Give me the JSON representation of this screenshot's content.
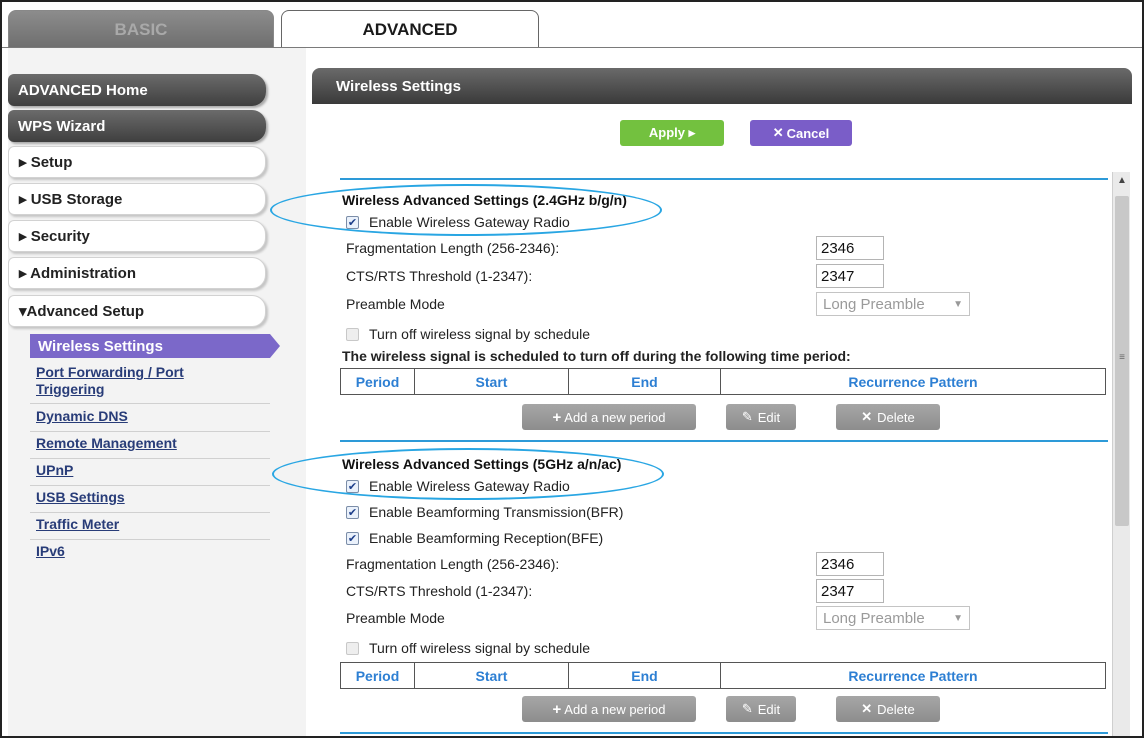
{
  "tabs": {
    "basic": "BASIC",
    "advanced": "ADVANCED"
  },
  "sidebar": {
    "advanced_home": "ADVANCED Home",
    "wps_wizard": "WPS Wizard",
    "setup": "▸ Setup",
    "usb_storage": "▸ USB Storage",
    "security": "▸ Security",
    "administration": "▸ Administration",
    "advanced_setup": "▾Advanced Setup",
    "submenu": {
      "wireless_settings": "Wireless Settings",
      "port_forwarding_1": "Port Forwarding / Port",
      "port_forwarding_2": "Triggering",
      "dynamic_dns": "Dynamic DNS",
      "remote_management": "Remote Management",
      "upnp": "UPnP",
      "usb_settings": "USB Settings",
      "traffic_meter": "Traffic Meter",
      "ipv6": "IPv6"
    }
  },
  "panel": {
    "title": "Wireless Settings",
    "apply": "Apply ▸",
    "cancel": "Cancel"
  },
  "band24": {
    "title": "Wireless Advanced Settings (2.4GHz b/g/n)",
    "enable_radio": "Enable Wireless Gateway Radio",
    "frag_label": "Fragmentation Length (256-2346):",
    "frag_value": "2346",
    "cts_label": "CTS/RTS Threshold (1-2347):",
    "cts_value": "2347",
    "preamble_label": "Preamble Mode",
    "preamble_value": "Long Preamble",
    "schedule_toggle": "Turn off wireless signal by schedule",
    "schedule_text": "The wireless signal is scheduled to turn off during the following time period:"
  },
  "band5": {
    "title": "Wireless Advanced Settings (5GHz a/n/ac)",
    "enable_radio": "Enable Wireless Gateway Radio",
    "bfr": "Enable Beamforming Transmission(BFR)",
    "bfe": "Enable Beamforming Reception(BFE)",
    "frag_label": "Fragmentation Length (256-2346):",
    "frag_value": "2346",
    "cts_label": "CTS/RTS Threshold (1-2347):",
    "cts_value": "2347",
    "preamble_label": "Preamble Mode",
    "preamble_value": "Long Preamble",
    "schedule_toggle": "Turn off wireless signal by schedule"
  },
  "table": {
    "period": "Period",
    "start": "Start",
    "end": "End",
    "recurrence": "Recurrence Pattern"
  },
  "buttons": {
    "add_period": "Add a new period",
    "edit": "Edit",
    "delete": "Delete"
  },
  "colors": {
    "apply": "#73c13f",
    "cancel": "#7a5dc8",
    "active_submenu": "#7b68c9",
    "highlight_ellipse": "#29a6e3",
    "separator": "#2d9ad8"
  }
}
